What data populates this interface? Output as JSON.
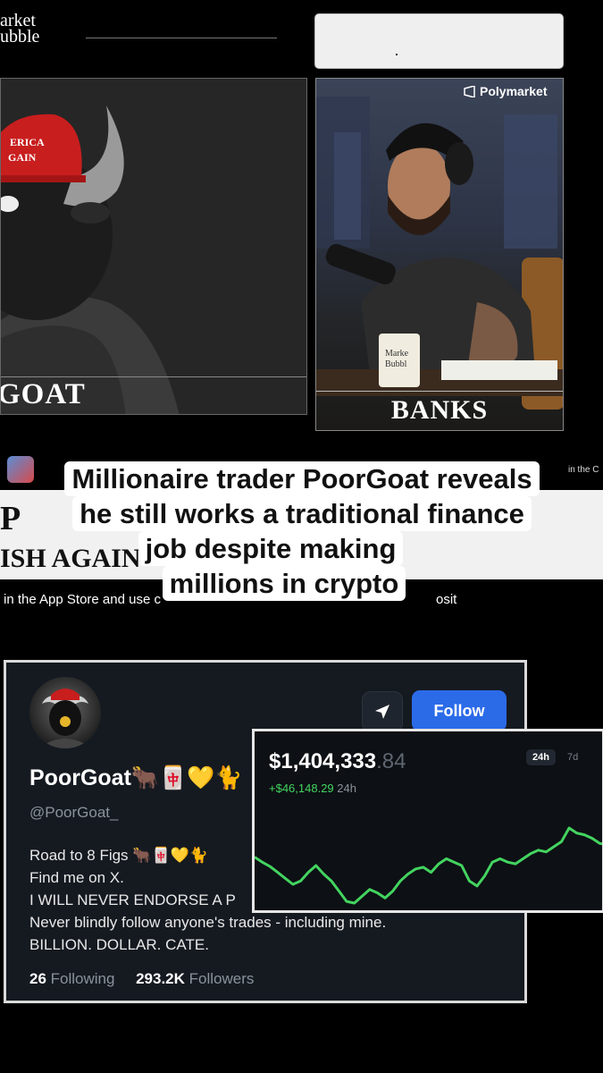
{
  "video": {
    "logo_lines": [
      "arket",
      "ubble"
    ],
    "left_panel_caption": "GOAT",
    "right_panel_caption": "BANKS",
    "right_panel_brand": "Polymarket",
    "mug_text": [
      "Marke",
      "Bubbl"
    ],
    "hat_text": [
      "ERICA",
      "GAIN"
    ]
  },
  "strip": {
    "big_letter": "P",
    "subtitle": "ISH AGAIN",
    "app_store_line": "in the App Store and use c",
    "deposit_fragment": "osit",
    "corner_text": "in the C"
  },
  "headline": {
    "lines": [
      "Millionaire trader PoorGoat reveals",
      "he still works a traditional finance",
      "job despite making",
      "millions in crypto"
    ]
  },
  "profile": {
    "name": "PoorGoat🐂🀄💛🐈",
    "handle": "@PoorGoat_",
    "follow_label": "Follow",
    "share_icon": "send-icon",
    "bio": [
      "Road to 8 Figs 🐂🀄💛🐈",
      "Find me on X.",
      "I WILL NEVER ENDORSE A P",
      "Never blindly follow anyone's trades - including mine.",
      "BILLION. DOLLAR. CATE."
    ],
    "following_count": "26",
    "following_label": "Following",
    "followers_count": "293.2K",
    "followers_label": "Followers",
    "colors": {
      "card_bg": "#151a21",
      "follow_bg": "#2b6be8"
    }
  },
  "pnl": {
    "amount_main": "$1,404,333",
    "amount_cents": ".84",
    "change": "+$46,148.29",
    "change_period": "24h",
    "tabs": [
      "24h",
      "7d"
    ],
    "active_tab": "24h",
    "line_color": "#43d460",
    "series_values": [
      58,
      52,
      47,
      40,
      33,
      26,
      30,
      40,
      48,
      38,
      30,
      18,
      6,
      4,
      12,
      20,
      16,
      10,
      18,
      30,
      38,
      44,
      46,
      40,
      50,
      56,
      52,
      48,
      30,
      24,
      36,
      52,
      56,
      52,
      50,
      56,
      62,
      66,
      64,
      70,
      76,
      92,
      86,
      84,
      80,
      74,
      72
    ]
  }
}
